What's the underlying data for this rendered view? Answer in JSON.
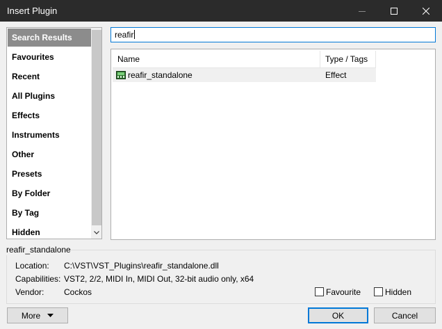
{
  "window": {
    "title": "Insert Plugin"
  },
  "sidebar": {
    "items": [
      {
        "label": "Search Results",
        "selected": true
      },
      {
        "label": "Favourites"
      },
      {
        "label": "Recent"
      },
      {
        "label": "All Plugins"
      },
      {
        "label": "Effects"
      },
      {
        "label": "Instruments"
      },
      {
        "label": "Other"
      },
      {
        "label": "Presets"
      },
      {
        "label": "By Folder"
      },
      {
        "label": "By Tag"
      },
      {
        "label": "Hidden"
      }
    ]
  },
  "search": {
    "value": "reafir"
  },
  "results": {
    "columns": [
      "Name",
      "Type / Tags"
    ],
    "rows": [
      {
        "name": "reafir_standalone",
        "type": "Effect",
        "icon": "plugin-icon"
      }
    ]
  },
  "details": {
    "title": "reafir_standalone",
    "location_label": "Location:",
    "location_value": "C:\\VST\\VST_Plugins\\reafir_standalone.dll",
    "capabilities_label": "Capabilities:",
    "capabilities_value": "VST2, 2/2, MIDI In, MIDI Out, 32-bit audio only, x64",
    "vendor_label": "Vendor:",
    "vendor_value": "Cockos",
    "favourite_label": "Favourite",
    "hidden_label": "Hidden"
  },
  "buttons": {
    "more": "More",
    "ok": "OK",
    "cancel": "Cancel"
  },
  "colors": {
    "accent": "#0078d7",
    "selected_bg": "#8c8c8c",
    "titlebar_bg": "#2b2b2b"
  }
}
